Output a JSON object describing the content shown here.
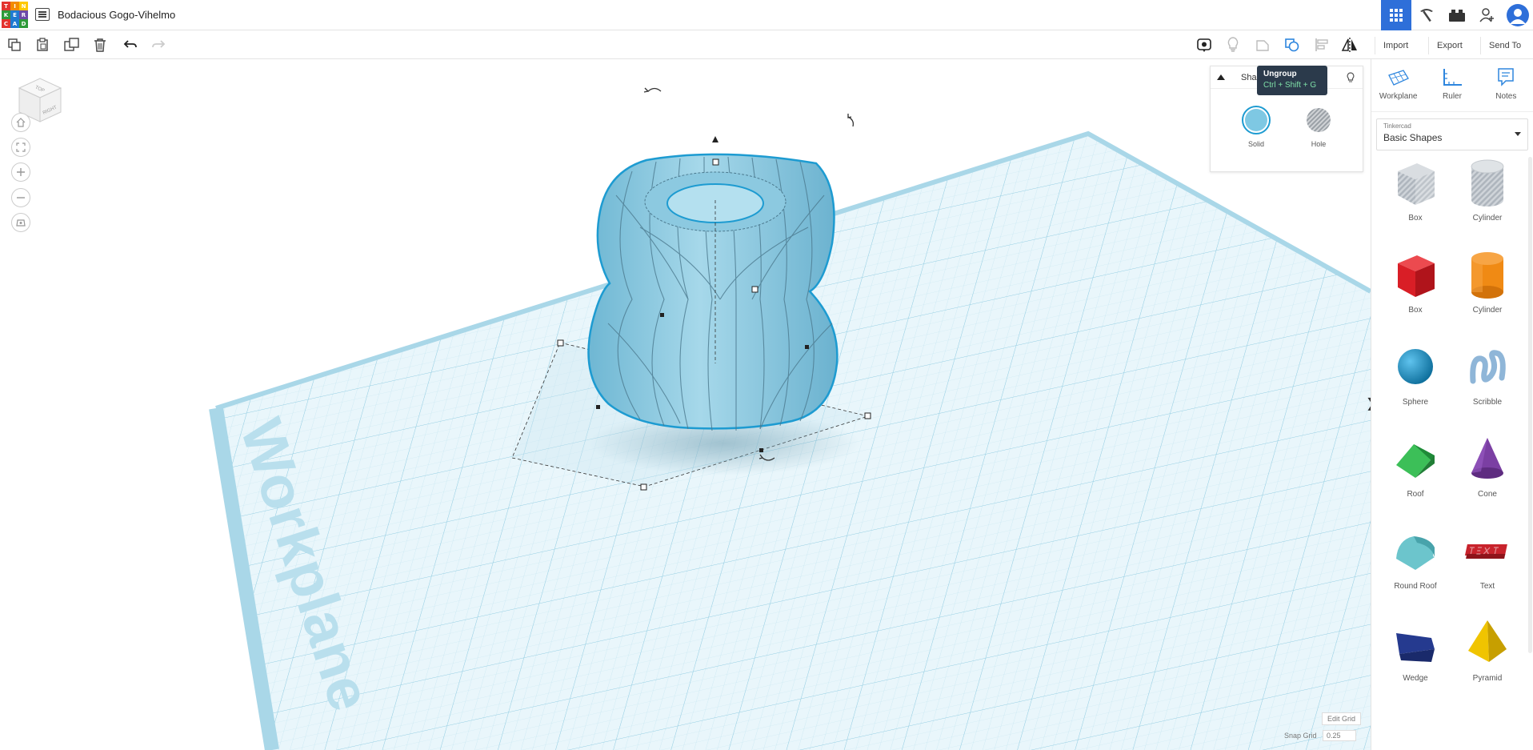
{
  "app": {
    "logo_letters": [
      "T",
      "I",
      "N",
      "K",
      "E",
      "R",
      "C",
      "A",
      "D"
    ],
    "logo_colors": [
      "#e3342f",
      "#f38b00",
      "#ffc800",
      "#2e9b3a",
      "#1f7ad1",
      "#6d4aa8",
      "#e3342f",
      "#1f7ad1",
      "#2e9b3a"
    ],
    "project_title": "Bodacious Gogo-Vihelmo"
  },
  "topbar": {
    "icons": [
      "grid-icon",
      "pickaxe-icon",
      "brick-icon",
      "add-user-icon",
      "avatar-icon"
    ]
  },
  "toolbar": {
    "left_icons": [
      "copy-icon",
      "paste-icon",
      "duplicate-icon",
      "delete-icon",
      "undo-icon",
      "redo-icon"
    ],
    "right_icons": [
      "show-all-icon",
      "lightbulb-icon",
      "group-icon",
      "ungroup-icon",
      "align-icon",
      "mirror-icon"
    ],
    "import_label": "Import",
    "export_label": "Export",
    "send_to_label": "Send To"
  },
  "tooltip": {
    "title": "Ungroup",
    "shortcut": "Ctrl + Shift + G"
  },
  "shape_inspector": {
    "title": "Sha",
    "solid_label": "Solid",
    "hole_label": "Hole",
    "solid_color": "#7ec8e3"
  },
  "navcube": {
    "top_label": "TOP",
    "right_label": "RIGHT"
  },
  "view_controls": [
    "home-icon",
    "fit-icon",
    "zoom-in-icon",
    "zoom-out-icon",
    "perspective-icon"
  ],
  "workplane": {
    "watermark": "Workplane",
    "edit_grid_label": "Edit Grid",
    "snap_grid_label": "Snap Grid",
    "snap_grid_value": "0.25"
  },
  "right_panel": {
    "tools": [
      {
        "label": "Workplane",
        "icon": "workplane-icon"
      },
      {
        "label": "Ruler",
        "icon": "ruler-icon"
      },
      {
        "label": "Notes",
        "icon": "notes-icon"
      }
    ],
    "library_small": "Tinkercad",
    "library_name": "Basic Shapes",
    "shapes": [
      {
        "label": "Box",
        "icon": "box-hole-icon",
        "color": "#b9c2cc"
      },
      {
        "label": "Cylinder",
        "icon": "cylinder-hole-icon",
        "color": "#b9c2cc"
      },
      {
        "label": "Box",
        "icon": "box-icon",
        "color": "#d91e26"
      },
      {
        "label": "Cylinder",
        "icon": "cylinder-icon",
        "color": "#f08a14"
      },
      {
        "label": "Sphere",
        "icon": "sphere-icon",
        "color": "#1c93c9"
      },
      {
        "label": "Scribble",
        "icon": "scribble-icon",
        "color": "#8fb6d8"
      },
      {
        "label": "Roof",
        "icon": "roof-icon",
        "color": "#2fa54a"
      },
      {
        "label": "Cone",
        "icon": "cone-icon",
        "color": "#7b3fa3"
      },
      {
        "label": "Round Roof",
        "icon": "round-roof-icon",
        "color": "#6cc5cc"
      },
      {
        "label": "Text",
        "icon": "text-icon",
        "color": "#c8232c"
      },
      {
        "label": "Wedge",
        "icon": "wedge-icon",
        "color": "#253a8f"
      },
      {
        "label": "Pyramid",
        "icon": "pyramid-icon",
        "color": "#f0c400"
      }
    ]
  }
}
